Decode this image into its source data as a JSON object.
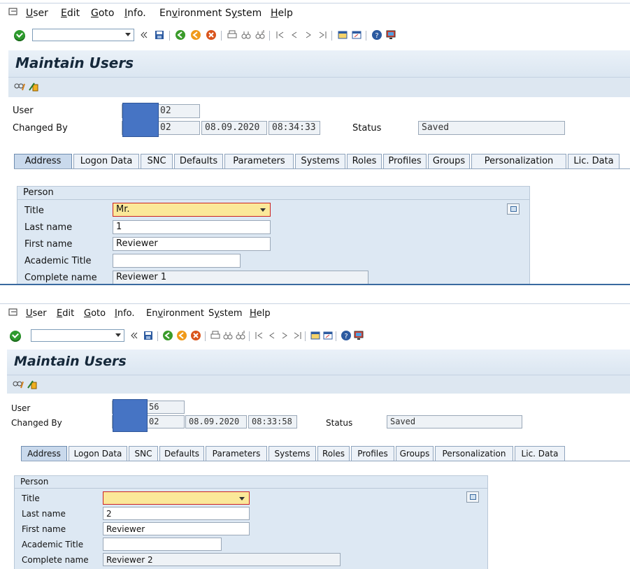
{
  "menu": [
    "User",
    "Edit",
    "Goto",
    "Info.",
    "Environment",
    "System",
    "Help"
  ],
  "menu_underline": [
    "U",
    "E",
    "G",
    "I",
    "v",
    "y",
    "H"
  ],
  "title": "Maintain Users",
  "labels": {
    "user": "User",
    "changed_by": "Changed By",
    "status": "Status",
    "group_person": "Person",
    "title": "Title",
    "last_name": "Last name",
    "first_name": "First name",
    "academic_title": "Academic Title",
    "complete_name": "Complete name"
  },
  "tabs": [
    "Address",
    "Logon Data",
    "SNC",
    "Defaults",
    "Parameters",
    "Systems",
    "Roles",
    "Profiles",
    "Groups",
    "Personalization",
    "Lic. Data"
  ],
  "active_tab": "Address",
  "screens": [
    {
      "user_suffix": "02",
      "changed_by_suffix": "02",
      "changed_date": "08.09.2020",
      "changed_time": "08:34:33",
      "status": "Saved",
      "title_value": "Mr.",
      "last_name": "1",
      "first_name": "Reviewer",
      "academic_title": "",
      "complete_name": "Reviewer 1"
    },
    {
      "user_suffix": "56",
      "changed_by_suffix": "02",
      "changed_date": "08.09.2020",
      "changed_time": "08:33:58",
      "status": "Saved",
      "title_value": "",
      "last_name": "2",
      "first_name": "Reviewer",
      "academic_title": "",
      "complete_name": "Reviewer 2"
    }
  ],
  "colors": {
    "redaction": "#4674c4",
    "required_field": "#fbe899",
    "group_bg": "#dde8f3"
  }
}
